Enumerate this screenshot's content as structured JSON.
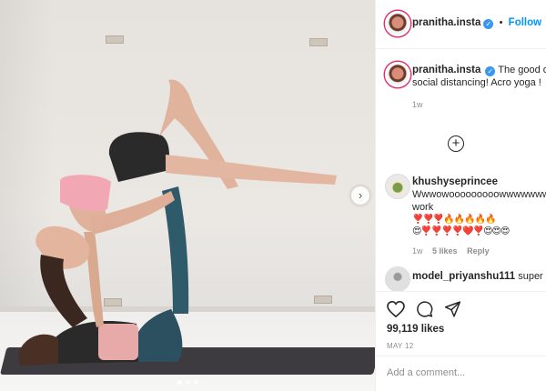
{
  "post": {
    "author": "pranitha.insta",
    "follow_label": "Follow",
    "bullet": "•",
    "verified_glyph": "✓",
    "caption_text": "The good old days when there was no social distancing! Acro yoga !",
    "caption_time": "1w",
    "load_more_glyph": "⊕",
    "comments": [
      {
        "user": "khushyseprincee",
        "text": "Wwwowooooooooowwwwwwwwww great and cool fitness work",
        "emoji_line1": "❣️❣️❣️🔥🔥🔥🔥🔥",
        "emoji_line2": "😍❣️❣️❣️❣️❤️❣️😍😍😍",
        "time": "1w",
        "likes": "5 likes",
        "reply": "Reply"
      },
      {
        "user": "model_priyanshu111",
        "text": "super ma"
      }
    ],
    "likes_count": "99,119 likes",
    "date": "MAY 12",
    "comment_placeholder": "Add a comment...",
    "next_glyph": "›"
  },
  "icons": {
    "verified": "verified-badge-icon",
    "like": "heart-icon",
    "comment": "comment-bubble-icon",
    "share": "paper-plane-icon",
    "load_more": "plus-circle-icon",
    "next": "chevron-right-icon"
  },
  "colors": {
    "follow": "#0095f6",
    "verified": "#3897f0",
    "meta": "#8e8e8e",
    "text": "#262626",
    "border": "#efefef"
  }
}
